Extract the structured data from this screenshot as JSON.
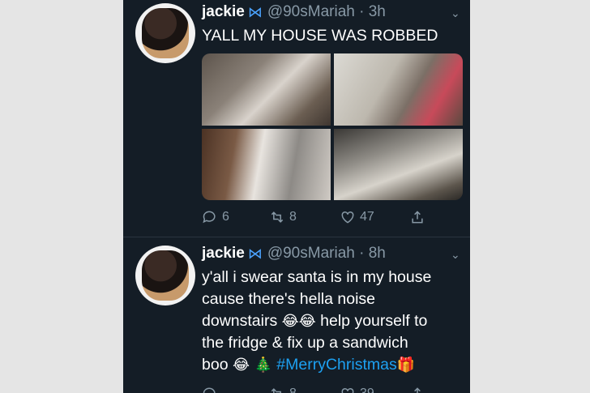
{
  "tweets": [
    {
      "display_name": "jackie",
      "verified_icon": "butterfly-icon",
      "handle": "@90sMariah",
      "time": "· 3h",
      "text": "YALL MY HOUSE WAS ROBBED",
      "media": [
        "photo-1",
        "photo-2",
        "photo-3",
        "photo-4"
      ],
      "replies": "6",
      "retweets": "8",
      "likes": "47"
    },
    {
      "display_name": "jackie",
      "verified_icon": "butterfly-icon",
      "handle": "@90sMariah",
      "time": "· 8h",
      "text_lines": [
        "y'all i swear santa is in my house",
        "cause there's hella noise",
        "downstairs",
        "help yourself to",
        "the fridge & fix up a sandwich",
        "boo"
      ],
      "emoji_laugh": "😂",
      "emoji_tree": "🎄",
      "hashtag": "#MerryChristmas",
      "emoji_gift": "🎁",
      "replies": "",
      "retweets": "8",
      "likes": "39"
    }
  ],
  "colors": {
    "background": "#e5e5e5",
    "feed": "#141d26",
    "text": "#ffffff",
    "muted": "#8899a6",
    "link": "#1da1f2"
  }
}
